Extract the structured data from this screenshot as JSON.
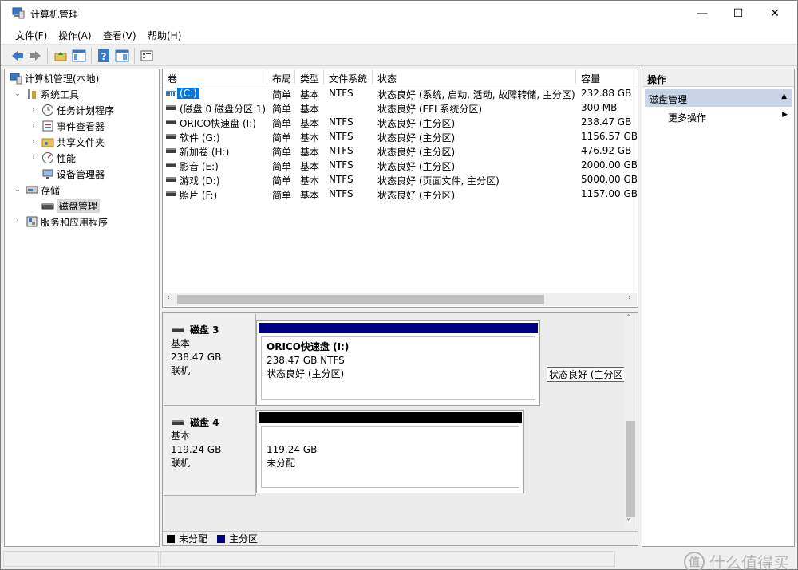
{
  "window": {
    "title": "计算机管理",
    "minimize": "—",
    "maximize": "☐",
    "close": "✕"
  },
  "menu": [
    "文件(F)",
    "操作(A)",
    "查看(V)",
    "帮助(H)"
  ],
  "tree": {
    "root": "计算机管理(本地)",
    "system_tools": "系统工具",
    "task_scheduler": "任务计划程序",
    "event_viewer": "事件查看器",
    "shared_folders": "共享文件夹",
    "performance": "性能",
    "device_manager": "设备管理器",
    "storage": "存储",
    "disk_management": "磁盘管理",
    "services_apps": "服务和应用程序"
  },
  "volume_list": {
    "headers": [
      "卷",
      "布局",
      "类型",
      "文件系统",
      "状态",
      "容量"
    ],
    "rows": [
      {
        "volume": "(C:)",
        "layout": "简单",
        "type": "基本",
        "fs": "NTFS",
        "status": "状态良好 (系统, 启动, 活动, 故障转储, 主分区)",
        "capacity": "232.88 GB",
        "icon": "volume-striped-icon",
        "selected": true
      },
      {
        "volume": "(磁盘 0 磁盘分区 1)",
        "layout": "简单",
        "type": "基本",
        "fs": "",
        "status": "状态良好 (EFI 系统分区)",
        "capacity": "300 MB",
        "icon": "volume-icon",
        "selected": false
      },
      {
        "volume": "ORICO快速盘 (I:)",
        "layout": "简单",
        "type": "基本",
        "fs": "NTFS",
        "status": "状态良好 (主分区)",
        "capacity": "238.47 GB",
        "icon": "volume-icon",
        "selected": false
      },
      {
        "volume": "软件 (G:)",
        "layout": "简单",
        "type": "基本",
        "fs": "NTFS",
        "status": "状态良好 (主分区)",
        "capacity": "1156.57 GB",
        "icon": "volume-icon",
        "selected": false
      },
      {
        "volume": "新加卷 (H:)",
        "layout": "简单",
        "type": "基本",
        "fs": "NTFS",
        "status": "状态良好 (主分区)",
        "capacity": "476.92 GB",
        "icon": "volume-icon",
        "selected": false
      },
      {
        "volume": "影音 (E:)",
        "layout": "简单",
        "type": "基本",
        "fs": "NTFS",
        "status": "状态良好 (主分区)",
        "capacity": "2000.00 GB",
        "icon": "volume-icon",
        "selected": false
      },
      {
        "volume": "游戏 (D:)",
        "layout": "简单",
        "type": "基本",
        "fs": "NTFS",
        "status": "状态良好 (页面文件, 主分区)",
        "capacity": "5000.00 GB",
        "icon": "volume-icon",
        "selected": false
      },
      {
        "volume": "照片 (F:)",
        "layout": "简单",
        "type": "基本",
        "fs": "NTFS",
        "status": "状态良好 (主分区)",
        "capacity": "1157.00 GB",
        "icon": "volume-icon",
        "selected": false
      }
    ]
  },
  "disks": [
    {
      "name": "磁盘 3",
      "type": "基本",
      "size": "238.47 GB",
      "state": "联机",
      "partition": {
        "title": "ORICO快速盘  (I:)",
        "line1": "238.47 GB NTFS",
        "line2": "状态良好 (主分区)",
        "bar_color": "#000080"
      }
    },
    {
      "name": "磁盘 4",
      "type": "基本",
      "size": "119.24 GB",
      "state": "联机",
      "partition": {
        "title": "",
        "line1": "119.24 GB",
        "line2": "未分配",
        "bar_color": "#000000"
      }
    }
  ],
  "floating_status": "状态良好 (主分区)",
  "legend": [
    {
      "label": "未分配",
      "color": "#000000"
    },
    {
      "label": "主分区",
      "color": "#000080"
    }
  ],
  "actions": {
    "header": "操作",
    "section": "磁盘管理",
    "more": "更多操作"
  },
  "watermark": {
    "logo": "值",
    "text": "什么值得买"
  }
}
